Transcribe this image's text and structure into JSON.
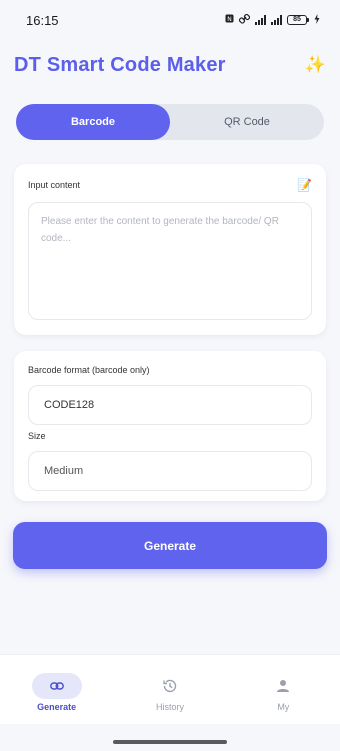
{
  "status_bar": {
    "time": "16:15",
    "battery": "85"
  },
  "header": {
    "title": "DT Smart Code Maker",
    "sparkle_icon": "sparkles-icon"
  },
  "tabs": [
    {
      "label": "Barcode",
      "active": true
    },
    {
      "label": "QR Code",
      "active": false
    }
  ],
  "input_card": {
    "label": "Input content",
    "icon": "memo-icon",
    "placeholder": "Please enter the content to generate the barcode/ QR code..."
  },
  "options_card": {
    "format_label": "Barcode format (barcode only)",
    "format_value": "CODE128",
    "size_label": "Size",
    "size_value": "Medium"
  },
  "generate_button": "Generate",
  "bottom_nav": [
    {
      "label": "Generate",
      "icon": "link-icon",
      "active": true
    },
    {
      "label": "History",
      "icon": "history-icon",
      "active": false
    },
    {
      "label": "My",
      "icon": "person-icon",
      "active": false
    }
  ],
  "colors": {
    "accent": "#6063ee",
    "title": "#5b5fe9",
    "background": "#f6f7fb"
  }
}
